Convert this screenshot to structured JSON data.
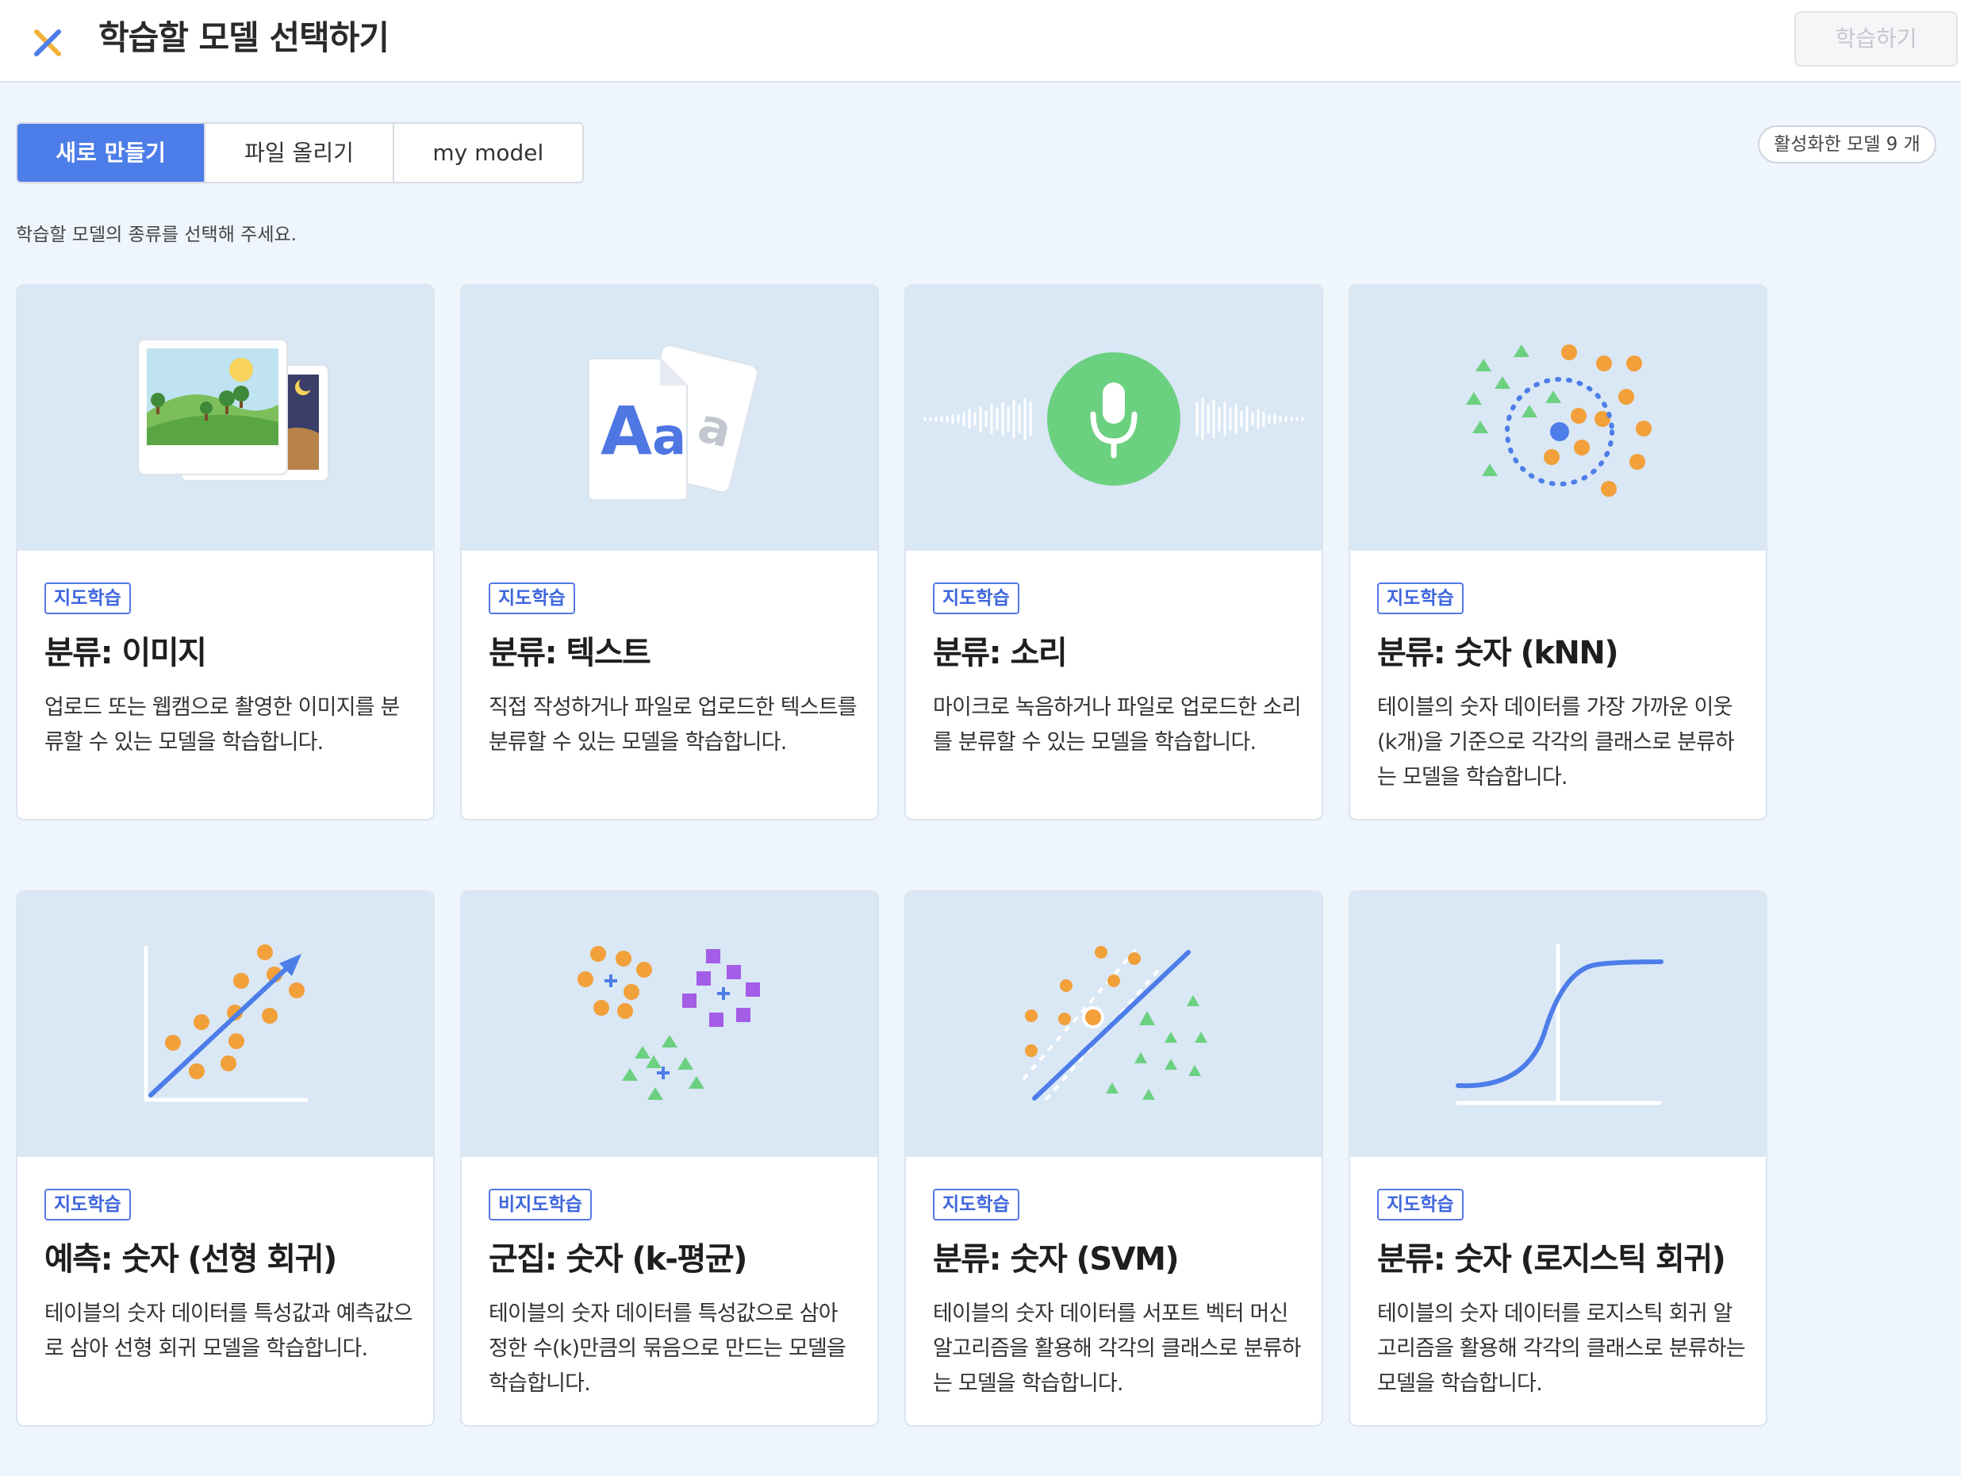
{
  "header": {
    "title": "학습할 모델 선택하기",
    "train_button": "학습하기"
  },
  "tabs": [
    {
      "label": "새로 만들기",
      "active": true
    },
    {
      "label": "파일 올리기",
      "active": false
    },
    {
      "label": "my model",
      "active": false
    }
  ],
  "active_models_label": "활성화한 모델 9 개",
  "instruction": "학습할 모델의 종류를 선택해 주세요.",
  "cards": [
    {
      "badge": "지도학습",
      "title": "분류: 이미지",
      "desc": "업로드 또는 웹캠으로 촬영한 이미지를 분류할 수 있는 모델을 학습합니다.",
      "icon": "image-classification-icon"
    },
    {
      "badge": "지도학습",
      "title": "분류: 텍스트",
      "desc": "직접 작성하거나 파일로 업로드한 텍스트를 분류할 수 있는 모델을 학습합니다.",
      "icon": "text-classification-icon"
    },
    {
      "badge": "지도학습",
      "title": "분류: 소리",
      "desc": "마이크로 녹음하거나 파일로 업로드한 소리를 분류할 수 있는 모델을 학습합니다.",
      "icon": "microphone-icon"
    },
    {
      "badge": "지도학습",
      "title": "분류: 숫자 (kNN)",
      "desc": "테이블의 숫자 데이터를 가장 가까운 이웃(k개)을 기준으로 각각의 클래스로 분류하는 모델을 학습합니다.",
      "icon": "knn-icon"
    },
    {
      "badge": "지도학습",
      "title": "예측: 숫자 (선형 회귀)",
      "desc": "테이블의 숫자 데이터를 특성값과 예측값으로 삼아 선형 회귀 모델을 학습합니다.",
      "icon": "linear-regression-icon"
    },
    {
      "badge": "비지도학습",
      "title": "군집: 숫자 (k-평균)",
      "desc": "테이블의 숫자 데이터를 특성값으로 삼아 정한 수(k)만큼의 묶음으로 만드는 모델을 학습합니다.",
      "icon": "kmeans-icon"
    },
    {
      "badge": "지도학습",
      "title": "분류: 숫자 (SVM)",
      "desc": "테이블의 숫자 데이터를 서포트 벡터 머신 알고리즘을 활용해 각각의 클래스로 분류하는 모델을 학습합니다.",
      "icon": "svm-icon"
    },
    {
      "badge": "지도학습",
      "title": "분류: 숫자 (로지스틱 회귀)",
      "desc": "테이블의 숫자 데이터를 로지스틱 회귀 알고리즘을 활용해 각각의 클래스로 분류하는 모델을 학습합니다.",
      "icon": "logistic-regression-icon"
    }
  ],
  "colors": {
    "accent": "#4c7de8",
    "illustration_bg": "#dae7f5",
    "page_bg": "#eef5fd",
    "green": "#6cd081",
    "orange": "#f2a03a",
    "purple": "#a35de6"
  }
}
